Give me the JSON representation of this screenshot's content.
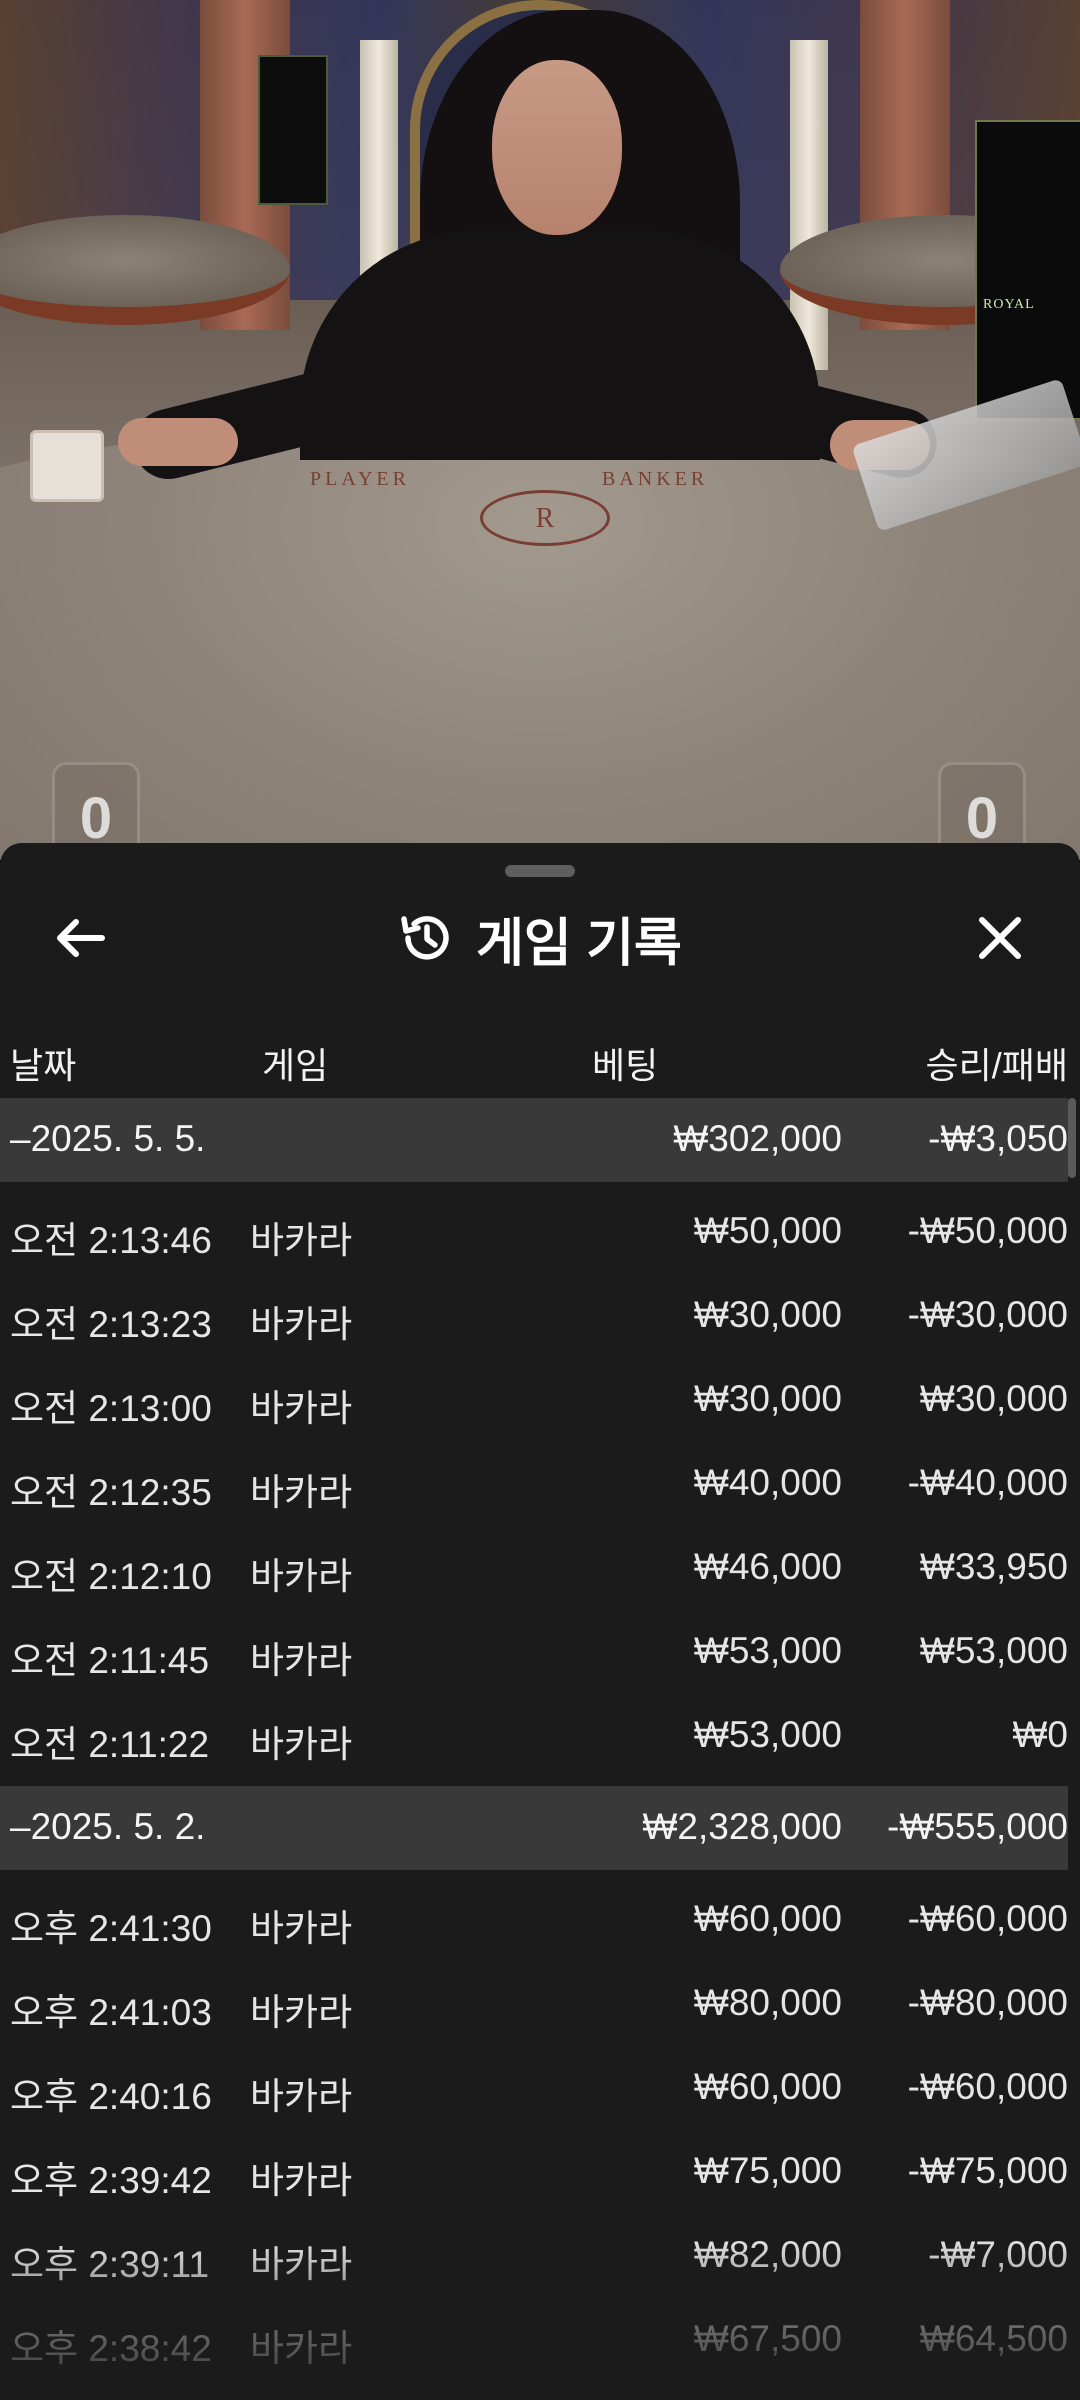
{
  "video": {
    "felt_labels": {
      "player": "PLAYER",
      "banker": "BANKER"
    },
    "emblem_letter": "R",
    "sign_text": "ROYAL",
    "player_score": "0",
    "banker_score": "0"
  },
  "header": {
    "title": "게임 기록",
    "back_icon": "arrow-left-icon",
    "history_icon": "history-clock-icon",
    "close_icon": "close-icon"
  },
  "columns": {
    "date": "날짜",
    "game": "게임",
    "bet": "베팅",
    "result": "승리/패배"
  },
  "groups": [
    {
      "date": "–2025. 5. 5.",
      "bet": "₩302,000",
      "result": "-₩3,050",
      "rows": [
        {
          "time": "오전 2:13:46",
          "game": "바카라",
          "bet": "₩50,000",
          "result": "-₩50,000"
        },
        {
          "time": "오전 2:13:23",
          "game": "바카라",
          "bet": "₩30,000",
          "result": "-₩30,000"
        },
        {
          "time": "오전 2:13:00",
          "game": "바카라",
          "bet": "₩30,000",
          "result": "₩30,000"
        },
        {
          "time": "오전 2:12:35",
          "game": "바카라",
          "bet": "₩40,000",
          "result": "-₩40,000"
        },
        {
          "time": "오전 2:12:10",
          "game": "바카라",
          "bet": "₩46,000",
          "result": "₩33,950"
        },
        {
          "time": "오전 2:11:45",
          "game": "바카라",
          "bet": "₩53,000",
          "result": "₩53,000"
        },
        {
          "time": "오전 2:11:22",
          "game": "바카라",
          "bet": "₩53,000",
          "result": "₩0"
        }
      ]
    },
    {
      "date": "–2025. 5. 2.",
      "bet": "₩2,328,000",
      "result": "-₩555,000",
      "rows": [
        {
          "time": "오후 2:41:30",
          "game": "바카라",
          "bet": "₩60,000",
          "result": "-₩60,000"
        },
        {
          "time": "오후 2:41:03",
          "game": "바카라",
          "bet": "₩80,000",
          "result": "-₩80,000"
        },
        {
          "time": "오후 2:40:16",
          "game": "바카라",
          "bet": "₩60,000",
          "result": "-₩60,000"
        },
        {
          "time": "오후 2:39:42",
          "game": "바카라",
          "bet": "₩75,000",
          "result": "-₩75,000"
        },
        {
          "time": "오후 2:39:11",
          "game": "바카라",
          "bet": "₩82,000",
          "result": "-₩7,000"
        },
        {
          "time": "오후 2:38:42",
          "game": "바카라",
          "bet": "₩67,500",
          "result": "₩64,500"
        }
      ]
    }
  ]
}
